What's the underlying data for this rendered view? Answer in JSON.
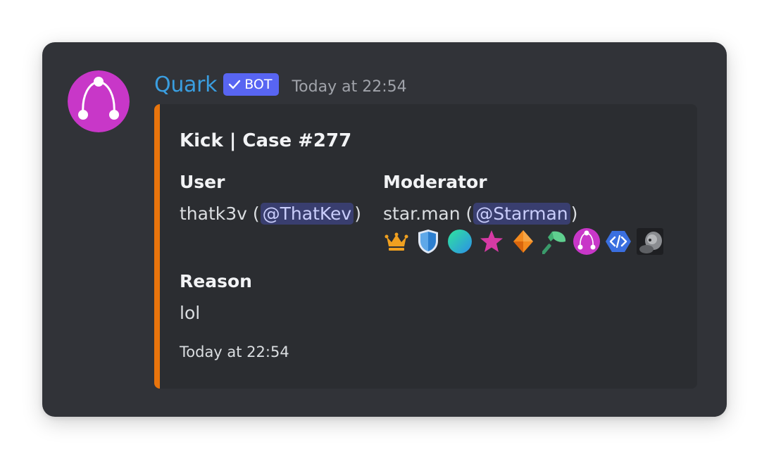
{
  "message": {
    "username": "Quark",
    "bot_tag": "BOT",
    "timestamp": "Today at 22:54"
  },
  "embed": {
    "accent_color": "#e8740c",
    "title": "Kick | Case #277",
    "fields": [
      {
        "name": "User",
        "value_prefix": "thatk3v (",
        "mention": "@ThatKev",
        "value_suffix": ")"
      },
      {
        "name": "Moderator",
        "value_prefix": "star.man (",
        "mention": "@Starman",
        "value_suffix": ")",
        "badges": [
          "crown-badge-icon",
          "shield-badge-icon",
          "gradient-orb-badge-icon",
          "star-badge-icon",
          "diamond-badge-icon",
          "axe-badge-icon",
          "quark-badge-icon",
          "code-badge-icon",
          "photo-badge-icon"
        ]
      },
      {
        "name": "Reason",
        "value": "lol"
      }
    ],
    "footer_timestamp": "Today at 22:54"
  },
  "colors": {
    "username": "#3a9ee0",
    "bot_tag": "#5865f2",
    "avatar": "#c837c8",
    "mention_bg": "#3e4271"
  }
}
